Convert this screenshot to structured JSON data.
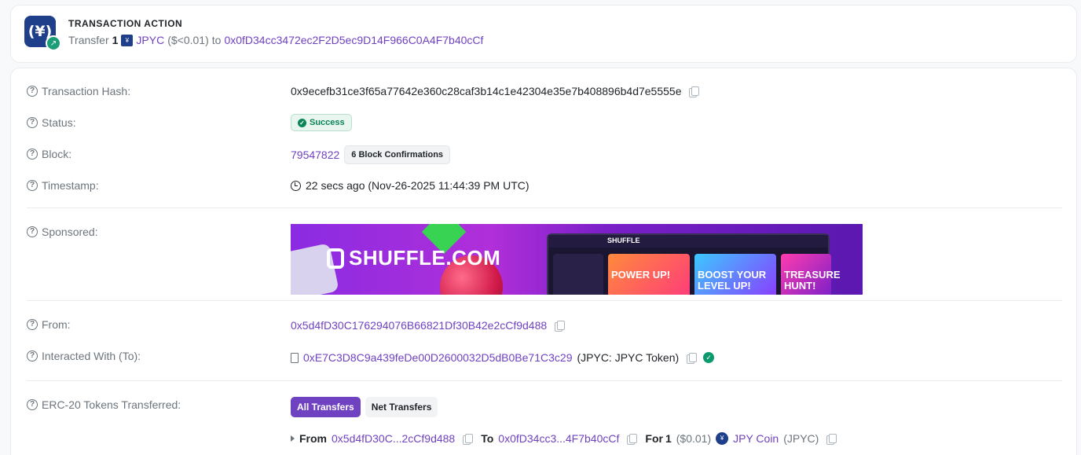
{
  "action": {
    "title": "TRANSACTION ACTION",
    "icon_text": "(¥)",
    "verb": "Transfer",
    "amount": "1",
    "token": "JPYC",
    "usd": "($<0.01)",
    "to_word": "to",
    "to_address": "0x0fD34cc3472ec2F2D5ec9D14F966C0A4F7b40cCf"
  },
  "details": {
    "hash_label": "Transaction Hash:",
    "hash_value": "0x9ecefb31ce3f65a77642e360c28caf3b14c1e42304e35e7b408896b4d7e5555e",
    "status_label": "Status:",
    "status_value": "Success",
    "block_label": "Block:",
    "block_value": "79547822",
    "block_confirmations": "6 Block Confirmations",
    "timestamp_label": "Timestamp:",
    "timestamp_value": "22 secs ago (Nov-26-2025 11:44:39 PM UTC)",
    "sponsored_label": "Sponsored:",
    "from_label": "From:",
    "from_value": "0x5d4fD30C176294076B66821Df30B42e2cCf9d488",
    "to_label": "Interacted With (To):",
    "to_value": "0xE7C3D8C9a439feDe00D2600032D5dB0Be71C3c29",
    "to_name": "(JPYC: JPYC Token)",
    "erc20_label": "ERC-20 Tokens Transferred:",
    "tab_all": "All Transfers",
    "tab_net": "Net Transfers",
    "transfer": {
      "from_word": "From",
      "from_short": "0x5d4fD30C...2cCf9d488",
      "to_word": "To",
      "to_short": "0x0fD34cc3...4F7b40cCf",
      "for_word": "For",
      "amount": "1",
      "usd": "($0.01)",
      "token_name": "JPY Coin",
      "token_symbol": "(JPYC)"
    }
  },
  "banner": {
    "brand": "SHUFFLE.COM",
    "mock_brand": "SHUFFLE",
    "tile1": "POWER UP!",
    "tile2": "BOOST YOUR LEVEL UP!",
    "tile3": "TREASURE HUNT!"
  },
  "colors": {
    "link": "#6f42c1",
    "success": "#0b8457",
    "token_blue": "#1f3f8a"
  }
}
